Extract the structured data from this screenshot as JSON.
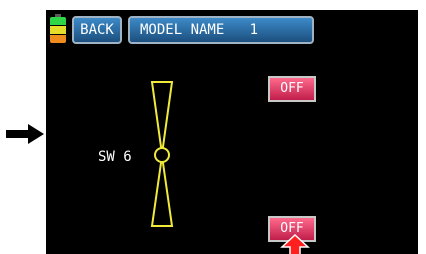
{
  "header": {
    "back_label": "BACK",
    "model_label": "MODEL NAME   1"
  },
  "battery": {
    "icon": "battery-icon",
    "level_colors": [
      "#2fd646",
      "#e6dc2a",
      "#f08c1e"
    ]
  },
  "switch": {
    "label": "SW 6",
    "upper_button_label": "OFF",
    "lower_button_label": "OFF",
    "diagram_icon": "switch-lever-icon",
    "diagram_color": "#f0ea3c"
  },
  "indicators": {
    "left_arrow_icon": "arrow-right-icon",
    "bottom_arrow_icon": "arrow-up-icon",
    "bottom_arrow_color": "#ff1f1f"
  },
  "colors": {
    "screen_bg": "#000000",
    "button_blue": "#2a6ea8",
    "off_button": "#e23a60"
  }
}
